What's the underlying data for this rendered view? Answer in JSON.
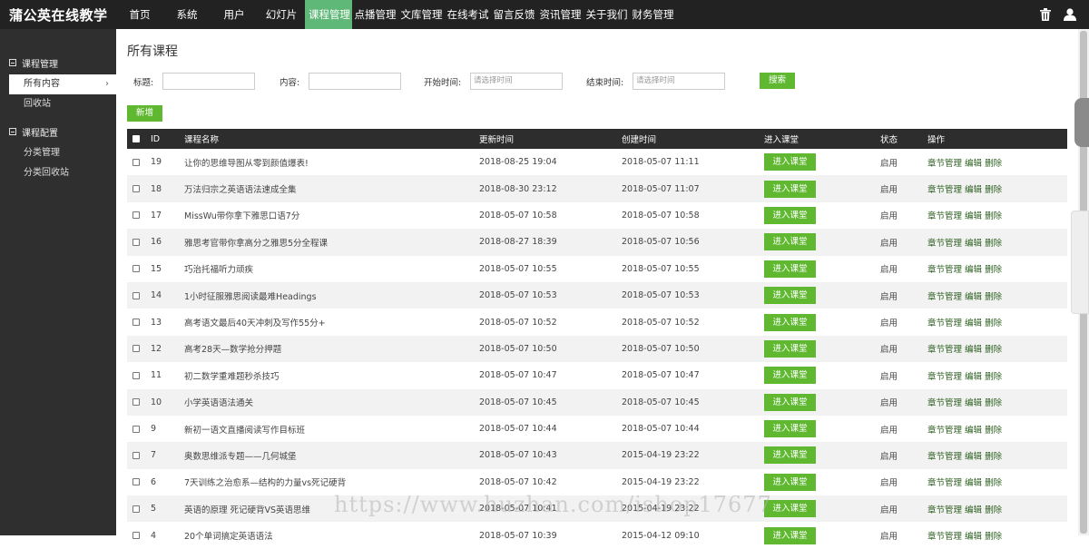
{
  "app": {
    "title": "蒲公英在线教学"
  },
  "topnav": {
    "items": [
      {
        "label": "首页",
        "active": false
      },
      {
        "label": "系统",
        "active": false
      },
      {
        "label": "用户",
        "active": false
      },
      {
        "label": "幻灯片",
        "active": false
      },
      {
        "label": "课程管理",
        "active": true
      },
      {
        "label": "点播管理",
        "active": false
      },
      {
        "label": "文库管理",
        "active": false
      },
      {
        "label": "在线考试",
        "active": false
      },
      {
        "label": "留言反馈",
        "active": false
      },
      {
        "label": "资讯管理",
        "active": false
      },
      {
        "label": "关于我们",
        "active": false
      },
      {
        "label": "财务管理",
        "active": false
      }
    ],
    "icons": [
      "trash-icon",
      "user-icon"
    ]
  },
  "sidebar": {
    "groups": [
      {
        "label": "课程管理",
        "items": [
          {
            "label": "所有内容",
            "active": true
          },
          {
            "label": "回收站",
            "active": false
          }
        ]
      },
      {
        "label": "课程配置",
        "items": [
          {
            "label": "分类管理",
            "active": false
          },
          {
            "label": "分类回收站",
            "active": false
          }
        ]
      }
    ]
  },
  "main": {
    "title": "所有课程",
    "filters": {
      "title_label": "标题:",
      "content_label": "内容:",
      "start_label": "开始时间:",
      "start_placeholder": "请选择时间",
      "end_label": "结束时间:",
      "end_placeholder": "请选择时间",
      "search_button": "搜索"
    },
    "add_button": "新增",
    "table": {
      "columns": [
        "ID",
        "课程名称",
        "更新时间",
        "创建时间",
        "进入课堂",
        "状态",
        "操作"
      ],
      "enter_label": "进入课堂",
      "ops": [
        "章节管理",
        "编辑",
        "删除"
      ],
      "rows": [
        {
          "id": "19",
          "name": "让你的思维导图从零到颜值爆表!",
          "updated": "2018-08-25 19:04",
          "created": "2018-05-07 11:11",
          "status": "启用"
        },
        {
          "id": "18",
          "name": "万法归宗之英语语法速成全集",
          "updated": "2018-08-30 23:12",
          "created": "2018-05-07 11:07",
          "status": "启用"
        },
        {
          "id": "17",
          "name": "MissWu带你拿下雅思口语7分",
          "updated": "2018-05-07 10:58",
          "created": "2018-05-07 10:58",
          "status": "启用"
        },
        {
          "id": "16",
          "name": "雅思考官带你拿高分之雅思5分全程课",
          "updated": "2018-08-27 18:39",
          "created": "2018-05-07 10:56",
          "status": "启用"
        },
        {
          "id": "15",
          "name": "巧治托福听力顽疾",
          "updated": "2018-05-07 10:55",
          "created": "2018-05-07 10:55",
          "status": "启用"
        },
        {
          "id": "14",
          "name": "1小时征服雅思阅读最难Headings",
          "updated": "2018-05-07 10:53",
          "created": "2018-05-07 10:53",
          "status": "启用"
        },
        {
          "id": "13",
          "name": "高考语文最后40天冲刺及写作55分+",
          "updated": "2018-05-07 10:52",
          "created": "2018-05-07 10:52",
          "status": "启用"
        },
        {
          "id": "12",
          "name": "高考28天—数学抢分押题",
          "updated": "2018-05-07 10:50",
          "created": "2018-05-07 10:50",
          "status": "启用"
        },
        {
          "id": "11",
          "name": "初二数学重难题秒杀技巧",
          "updated": "2018-05-07 10:47",
          "created": "2018-05-07 10:47",
          "status": "启用"
        },
        {
          "id": "10",
          "name": "小学英语语法通关",
          "updated": "2018-05-07 10:45",
          "created": "2018-05-07 10:45",
          "status": "启用"
        },
        {
          "id": "9",
          "name": "新初一语文直播阅读写作目标班",
          "updated": "2018-05-07 10:44",
          "created": "2018-05-07 10:44",
          "status": "启用"
        },
        {
          "id": "7",
          "name": "奥数思维派专题——几何城堡",
          "updated": "2018-05-07 10:43",
          "created": "2015-04-19 23:22",
          "status": "启用"
        },
        {
          "id": "6",
          "name": "7天训练之治愈系—结构的力量vs死记硬背",
          "updated": "2018-05-07 10:42",
          "created": "2015-04-19 23:22",
          "status": "启用"
        },
        {
          "id": "5",
          "name": "英语的原理 死记硬背VS英语思维",
          "updated": "2018-05-07 10:41",
          "created": "2015-04-19 23:22",
          "status": "启用"
        },
        {
          "id": "4",
          "name": "20个单词搞定英语语法",
          "updated": "2018-05-07 10:39",
          "created": "2015-04-12 09:10",
          "status": "启用"
        }
      ]
    }
  },
  "watermark": "https://www.huzhan.com/ishop17677",
  "colors": {
    "accent": "#5fb830",
    "nav_active": "#5fb878",
    "topbar": "#222222",
    "sidebar": "#2f2f2f",
    "thead": "#2d2d2d"
  }
}
